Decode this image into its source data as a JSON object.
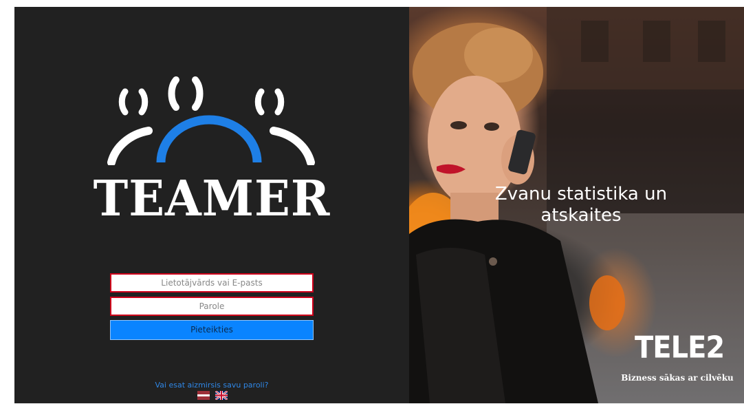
{
  "brand": {
    "name": "TEAMER"
  },
  "login": {
    "username_placeholder": "Lietotājvārds vai E-pasts",
    "username_value": "",
    "password_placeholder": "Parole",
    "password_value": "",
    "submit_label": "Pieteikties",
    "forgot_link": "Vai esat aizmirsis savu paroli?"
  },
  "languages": [
    {
      "icon": "latvia-flag-icon"
    },
    {
      "icon": "uk-flag-icon"
    }
  ],
  "promo": {
    "tagline_line1": "Zvanu statistika un",
    "tagline_line2": "atskaites",
    "partner_logo": "TELE2",
    "partner_slogan": "Bizness sākas ar cilvēku"
  },
  "colors": {
    "left_panel_bg": "#212121",
    "accent_blue": "#0a84ff",
    "field_border_error": "#d0021b",
    "link_blue": "#2f87e6"
  }
}
